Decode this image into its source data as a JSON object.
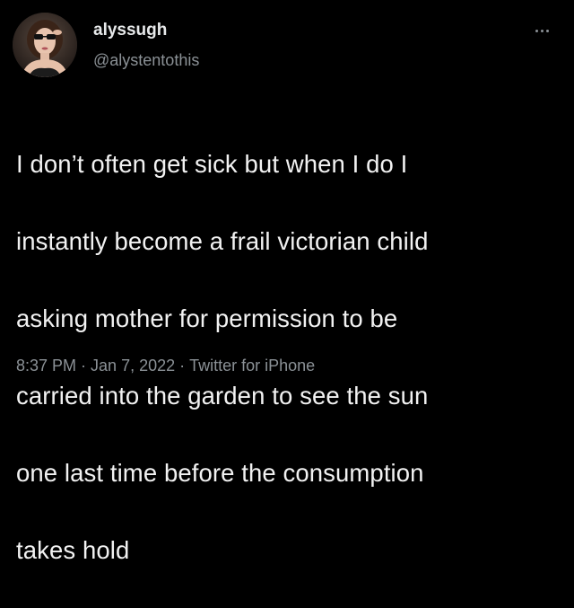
{
  "tweet": {
    "author": {
      "display_name": "alyssugh",
      "handle": "@alystentothis",
      "avatar_icon": "profile-photo"
    },
    "more_icon": "ellipsis-icon",
    "lines": [
      "I don’t often get sick but when I do I",
      "instantly become a frail victorian child",
      "asking mother for permission to be",
      "carried into the garden to see the sun",
      "one last time before the consumption",
      "takes hold"
    ],
    "time": "8:37 PM",
    "separator": "·",
    "date": "Jan 7, 2022",
    "source": "Twitter for iPhone"
  },
  "colors": {
    "background": "#000000",
    "primary_text": "#e7e9ea",
    "secondary_text": "#8b9196"
  }
}
